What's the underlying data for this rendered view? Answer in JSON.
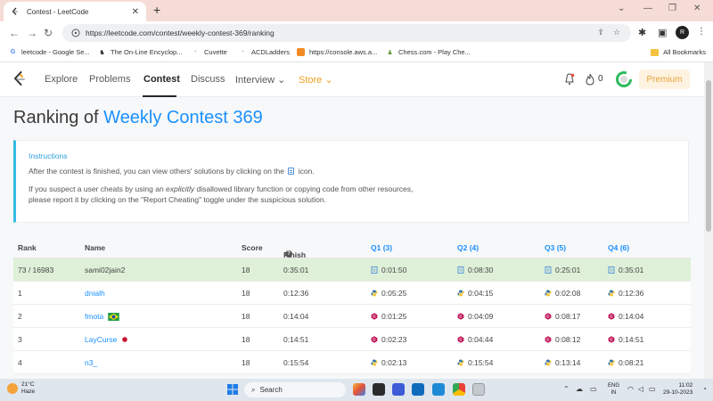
{
  "browser": {
    "tab_title": "Contest - LeetCode",
    "url": "https://leetcode.com/contest/weekly-contest-369/ranking",
    "profile_initial": "R",
    "bookmarks": [
      {
        "label": "leetcode - Google Se...",
        "icon": "google-icon"
      },
      {
        "label": "The On-Line Encyclop...",
        "icon": "oeis-icon"
      },
      {
        "label": "Cuvette",
        "icon": "cuvette-icon"
      },
      {
        "label": "ACDLadders",
        "icon": "acd-icon"
      },
      {
        "label": "https://console.aws.a...",
        "icon": "aws-icon"
      },
      {
        "label": "Chess.com - Play Che...",
        "icon": "chess-icon"
      }
    ],
    "all_bookmarks": "All Bookmarks"
  },
  "navbar": {
    "items": [
      "Explore",
      "Problems",
      "Contest",
      "Discuss",
      "Interview",
      "Store"
    ],
    "streak": "0",
    "premium": "Premium"
  },
  "page": {
    "title_prefix": "Ranking of ",
    "title_link": "Weekly Contest 369",
    "instructions": {
      "heading": "Instructions",
      "line1a": "After the contest is finished, you can view others' solutions by clicking on the",
      "line1b": "icon.",
      "line2a": "If you suspect a user cheats by using an ",
      "line2em": "explicitly",
      "line2b": " disallowed library function or copying code from other resources,",
      "line3": "please report it by clicking on the \"Report Cheating\" toggle under the suspicious solution."
    }
  },
  "table": {
    "headers": {
      "rank": "Rank",
      "name": "Name",
      "score": "Score",
      "finish": "Finish Time",
      "q1": "Q1 (3)",
      "q2": "Q2 (4)",
      "q3": "Q3 (5)",
      "q4": "Q4 (6)"
    },
    "rows": [
      {
        "rank": "73 / 16983",
        "name": "sami02jain2",
        "score": "18",
        "finish": "0:35:01",
        "q": [
          "0:01:50",
          "0:08:30",
          "0:25:01",
          "0:35:01"
        ],
        "langs": [
          "doc",
          "doc",
          "doc",
          "doc"
        ],
        "me": true
      },
      {
        "rank": "1",
        "name": "dnialh",
        "score": "18",
        "finish": "0:12:36",
        "q": [
          "0:05:25",
          "0:04:15",
          "0:02:08",
          "0:12:36"
        ],
        "langs": [
          "py",
          "py",
          "py",
          "py"
        ]
      },
      {
        "rank": "2",
        "name": "fmota",
        "score": "18",
        "finish": "0:14:04",
        "q": [
          "0:01:25",
          "0:04:09",
          "0:08:17",
          "0:14:04"
        ],
        "langs": [
          "cpp",
          "cpp",
          "cpp",
          "cpp"
        ],
        "flag": "brazil"
      },
      {
        "rank": "3",
        "name": "LayCurse",
        "score": "18",
        "finish": "0:14:51",
        "q": [
          "0:02:23",
          "0:04:44",
          "0:08:12",
          "0:14:51"
        ],
        "langs": [
          "cpp",
          "cpp",
          "cpp",
          "cpp"
        ],
        "flag": "japan"
      },
      {
        "rank": "4",
        "name": "n3_",
        "score": "18",
        "finish": "0:15:54",
        "q": [
          "0:02:13",
          "0:15:54",
          "0:13:14",
          "0:08:21"
        ],
        "langs": [
          "py",
          "py",
          "py",
          "py"
        ]
      }
    ]
  },
  "taskbar": {
    "temp": "21°C",
    "weather": "Haze",
    "search": "Search",
    "lang1": "ENG",
    "lang2": "IN",
    "time": "11:02",
    "date": "29-10-2023"
  }
}
